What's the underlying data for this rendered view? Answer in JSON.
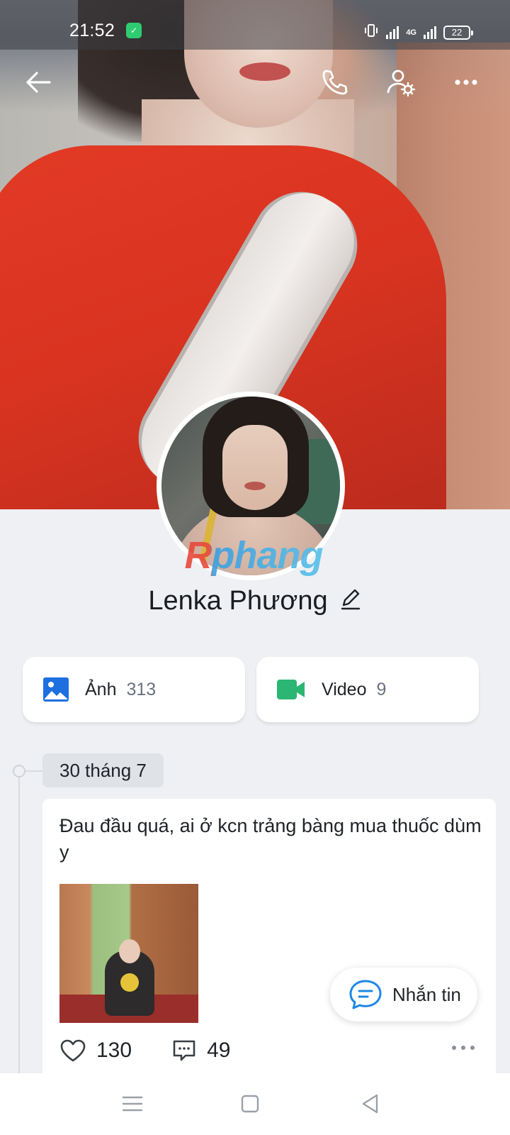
{
  "status_bar": {
    "time": "21:52",
    "network": "4G",
    "battery": "22"
  },
  "profile": {
    "name": "Lenka Phương",
    "watermark": "Rphang"
  },
  "media": {
    "photos": {
      "label": "Ảnh",
      "count": "313",
      "icon": "image-icon",
      "color": "#1e6fe0"
    },
    "videos": {
      "label": "Video",
      "count": "9",
      "icon": "video-camera-icon",
      "color": "#2bb673"
    }
  },
  "timeline": {
    "date": "30 tháng 7",
    "post": {
      "text": "Đau đầu quá, ai ở kcn trảng bàng mua thuốc dùm y",
      "likes": "130",
      "comments": "49"
    }
  },
  "message_button": {
    "label": "Nhắn tin",
    "accent": "#1e88e5"
  },
  "icons": {
    "back": "arrow-left-icon",
    "call": "phone-icon",
    "settings": "user-settings-icon",
    "more": "more-icon"
  }
}
